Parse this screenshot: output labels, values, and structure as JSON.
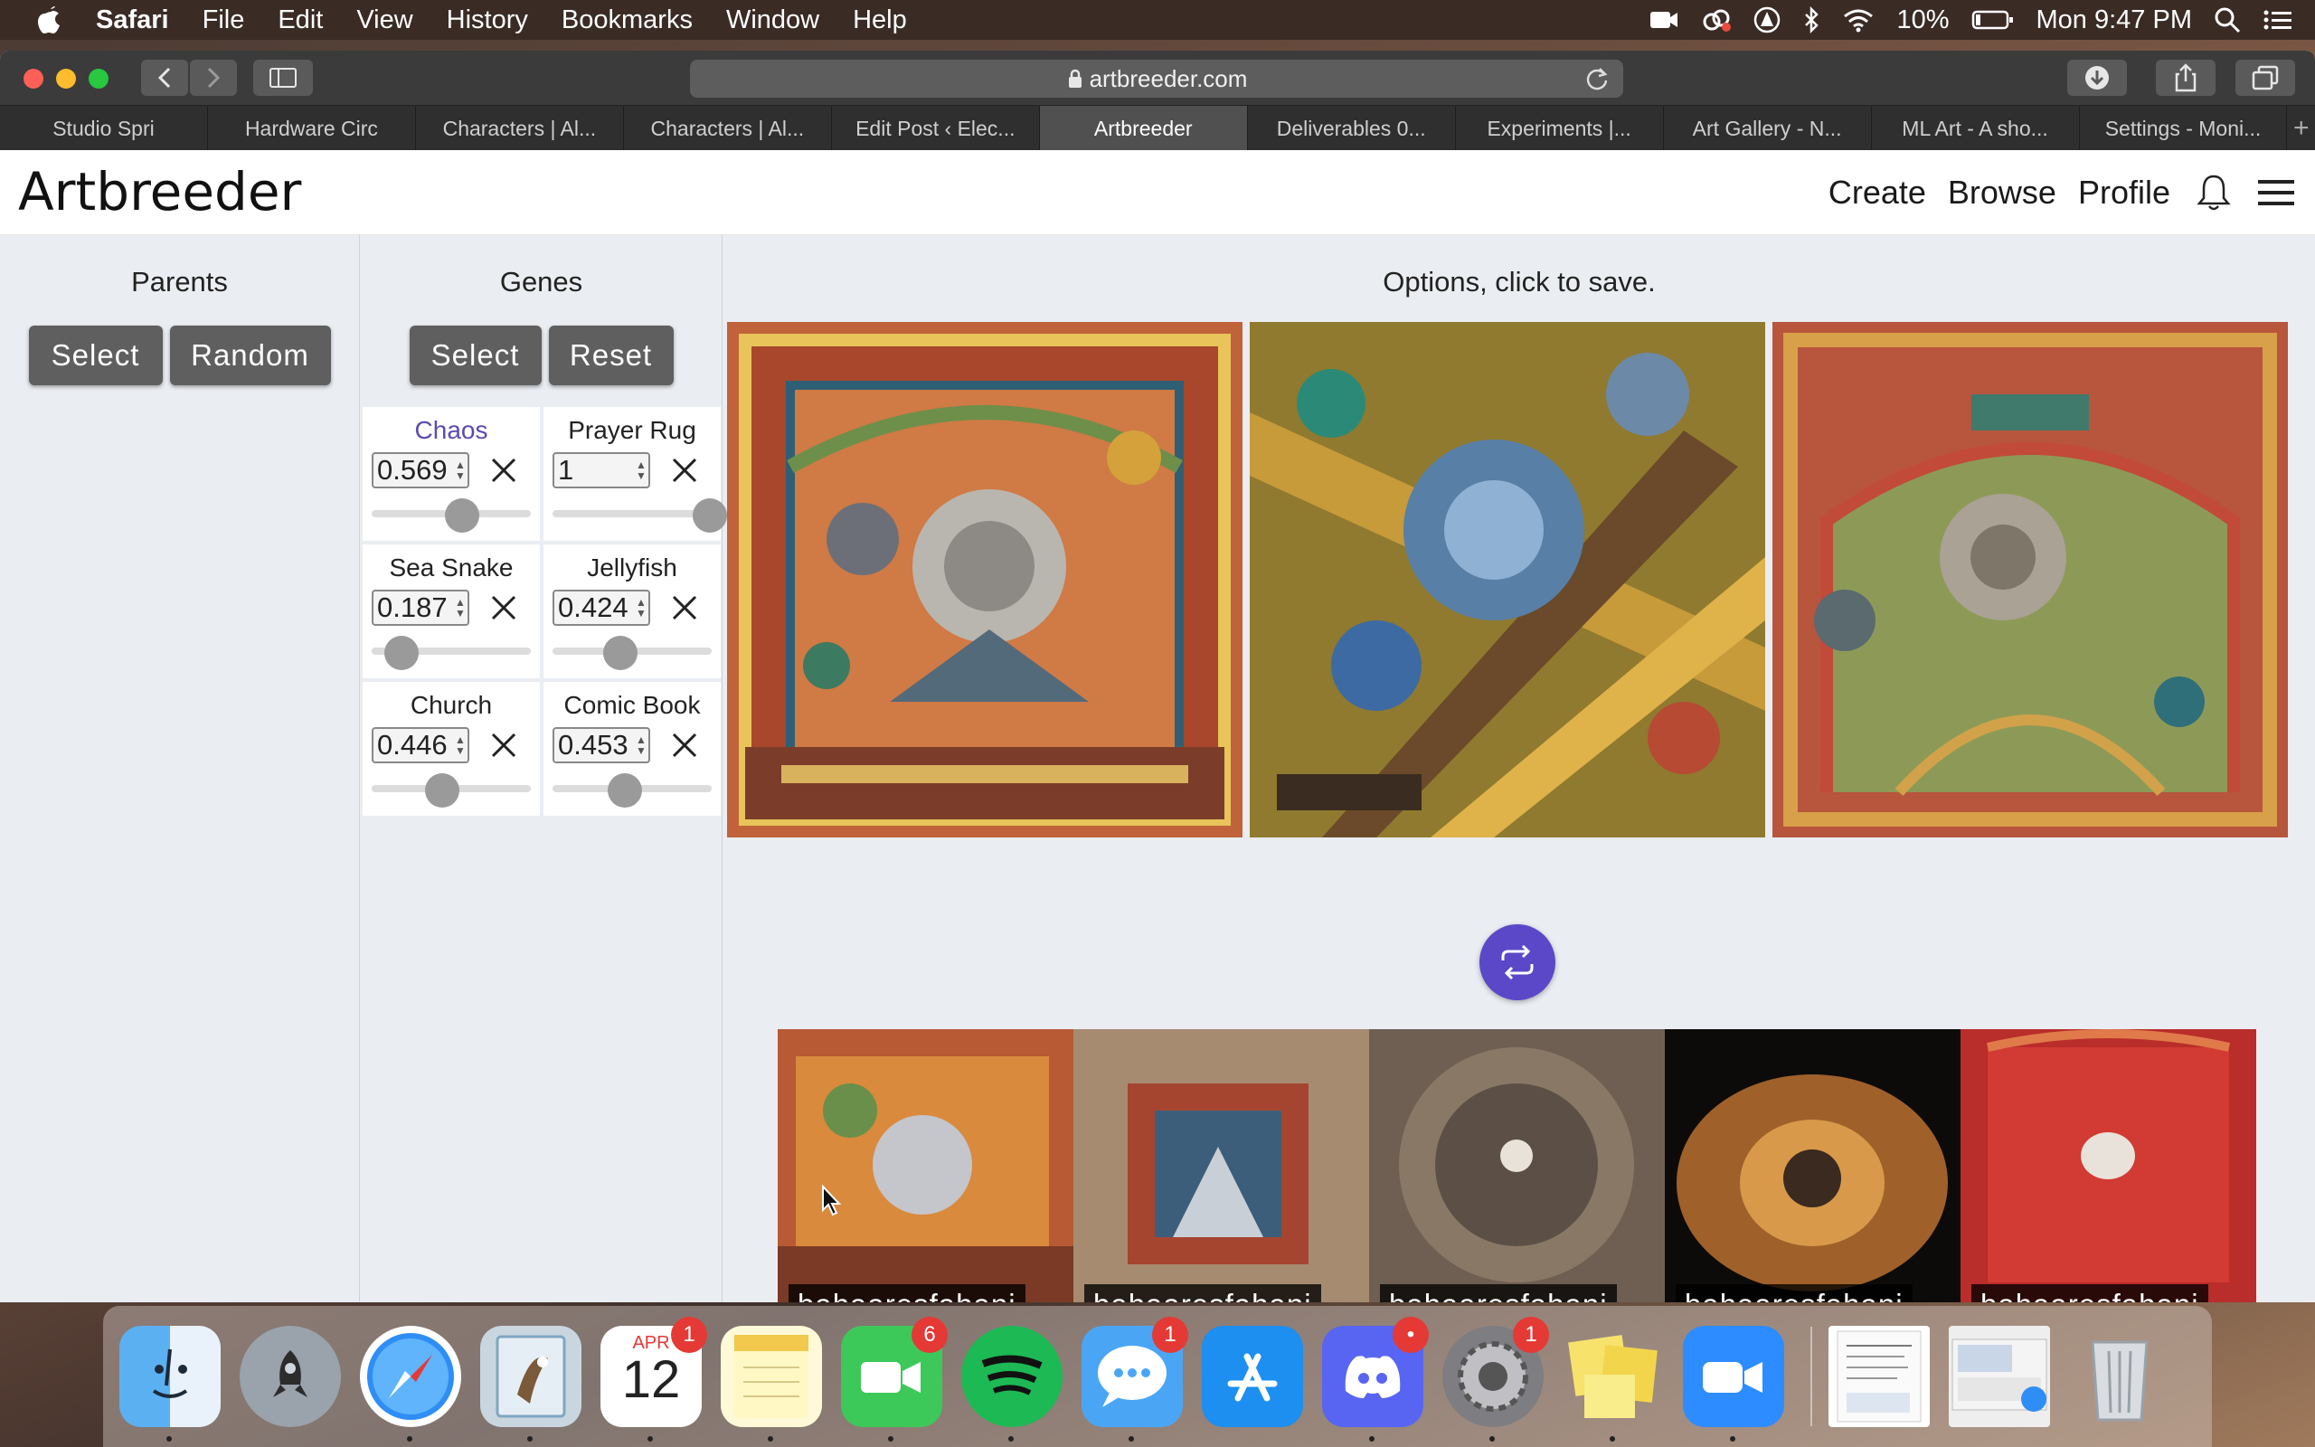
{
  "menubar": {
    "app_name": "Safari",
    "items": [
      "File",
      "Edit",
      "View",
      "History",
      "Bookmarks",
      "Window",
      "Help"
    ],
    "battery": "10%",
    "clock": "Mon 9:47 PM"
  },
  "browser": {
    "url": "artbreeder.com",
    "tabs": [
      {
        "label": "Studio Spri",
        "active": false
      },
      {
        "label": "Hardware Circ",
        "active": false
      },
      {
        "label": "Characters | Al...",
        "active": false
      },
      {
        "label": "Characters | Al...",
        "active": false
      },
      {
        "label": "Edit Post ‹ Elec...",
        "active": false
      },
      {
        "label": "Artbreeder",
        "active": true
      },
      {
        "label": "Deliverables 0...",
        "active": false
      },
      {
        "label": "Experiments |...",
        "active": false
      },
      {
        "label": "Art Gallery - N...",
        "active": false
      },
      {
        "label": "ML Art - A sho...",
        "active": false
      },
      {
        "label": "Settings - Moni...",
        "active": false
      }
    ],
    "new_tab_label": "+"
  },
  "site": {
    "logo": "Artbreeder",
    "nav": [
      "Create",
      "Browse",
      "Profile"
    ]
  },
  "parents": {
    "title": "Parents",
    "buttons": [
      "Select",
      "Random"
    ]
  },
  "genes": {
    "title": "Genes",
    "buttons": [
      "Select",
      "Reset"
    ],
    "items": [
      {
        "name": "Chaos",
        "value": "0.569",
        "level": 0.569,
        "highlight": true
      },
      {
        "name": "Prayer Rug",
        "value": "1",
        "level": 1.0,
        "highlight": false
      },
      {
        "name": "Sea Snake",
        "value": "0.187",
        "level": 0.187,
        "highlight": false
      },
      {
        "name": "Jellyfish",
        "value": "0.424",
        "level": 0.424,
        "highlight": false
      },
      {
        "name": "Church",
        "value": "0.446",
        "level": 0.446,
        "highlight": false
      },
      {
        "name": "Comic Book",
        "value": "0.453",
        "level": 0.453,
        "highlight": false
      }
    ]
  },
  "options": {
    "title": "Options, click to save."
  },
  "thumbnails": [
    {
      "user": "bahaaresfahani"
    },
    {
      "user": "bahaaresfahani"
    },
    {
      "user": "bahaaresfahani"
    },
    {
      "user": "bahaaresfahani"
    },
    {
      "user": "bahaaresfahani"
    }
  ],
  "dock": {
    "calendar_month": "APR",
    "calendar_day": "12",
    "badges": {
      "calendar": "1",
      "facetime": "6",
      "messages": "1",
      "discord": "•",
      "settings": "1"
    }
  },
  "colors": {
    "accent": "#5a48c9",
    "highlight_gene": "#5b4bb0",
    "button": "#5f5f5f"
  }
}
